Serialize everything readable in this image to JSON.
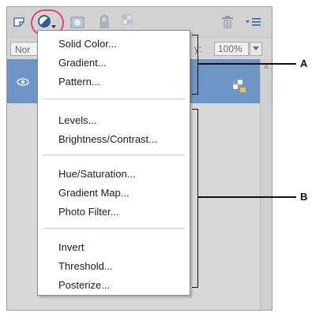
{
  "toolbar": {
    "icons": [
      "new-layer-icon",
      "adjustment-layer-icon",
      "layer-mask-icon",
      "lock-icon",
      "lock-transparency-icon",
      "trash-icon",
      "panel-menu-icon"
    ],
    "highlight_color": "#e8427a"
  },
  "options": {
    "blend_mode": "Nor",
    "opacity_label": "y:",
    "opacity_value": "100%"
  },
  "layer": {
    "selected_color": "#6d96c6"
  },
  "menu": {
    "groups": [
      [
        "Solid Color...",
        "Gradient...",
        "Pattern..."
      ],
      [
        "Levels...",
        "Brightness/Contrast..."
      ],
      [
        "Hue/Saturation...",
        "Gradient Map...",
        "Photo Filter..."
      ],
      [
        "Invert",
        "Threshold...",
        "Posterize..."
      ]
    ]
  },
  "callouts": {
    "a": "A",
    "b": "B"
  }
}
